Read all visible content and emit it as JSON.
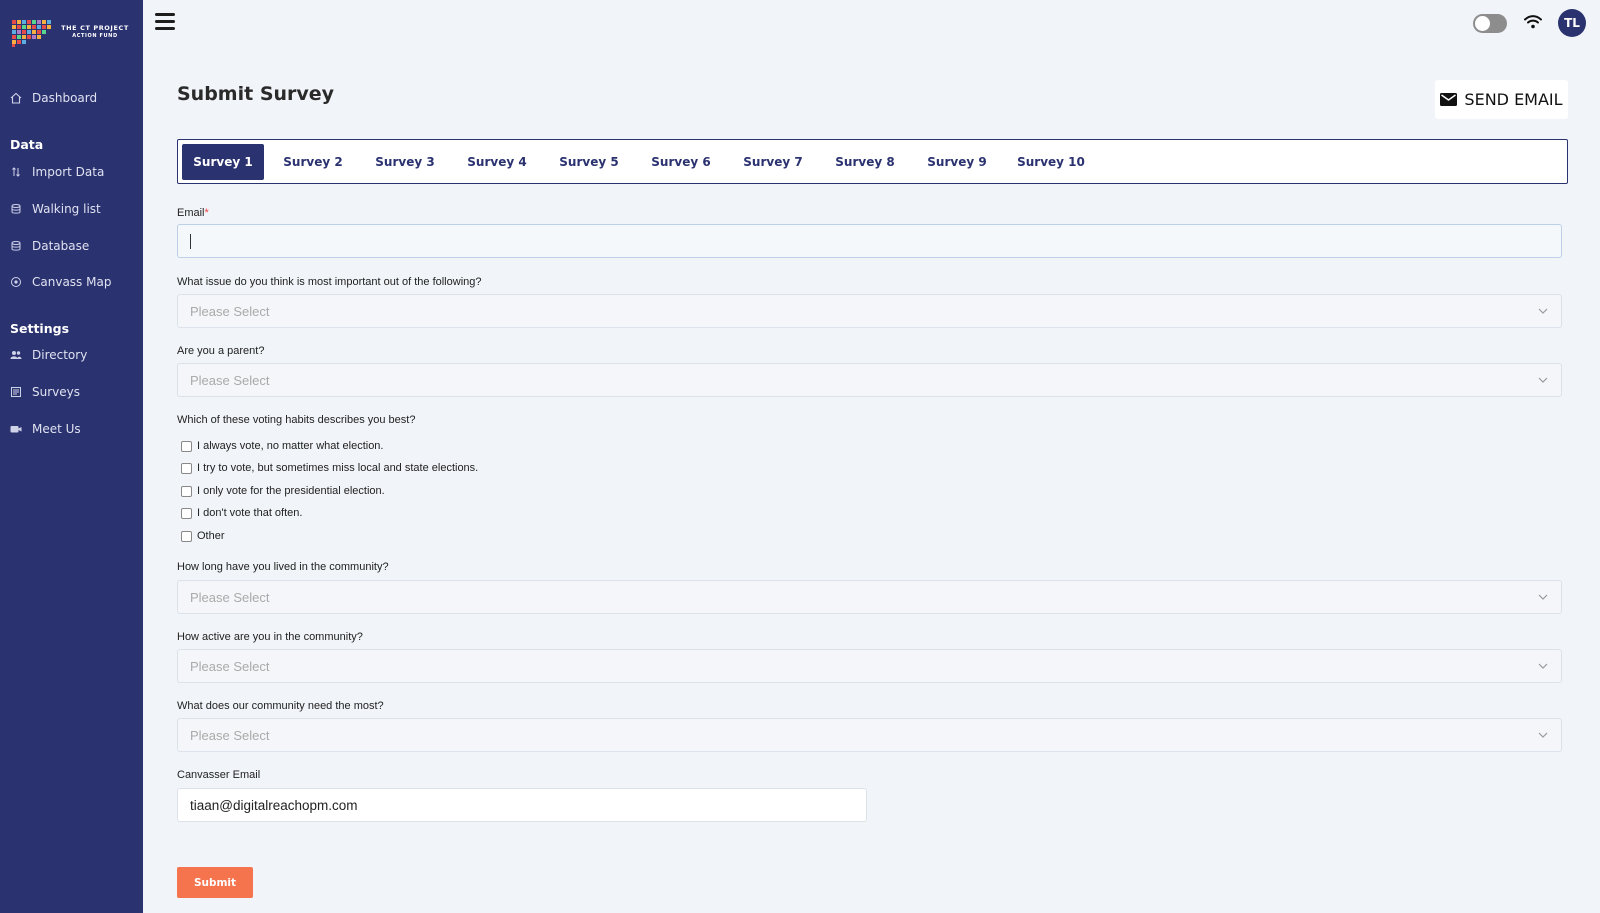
{
  "brand": {
    "line1": "THE CT PROJECT",
    "line2": "ACTION FUND"
  },
  "sidebar": {
    "items": [
      {
        "label": "Dashboard",
        "icon": "home-icon"
      },
      {
        "label": "Import Data",
        "icon": "import-icon"
      },
      {
        "label": "Walking list",
        "icon": "stack-icon"
      },
      {
        "label": "Database",
        "icon": "database-icon"
      },
      {
        "label": "Canvass Map",
        "icon": "map-pin-icon"
      },
      {
        "label": "Directory",
        "icon": "people-icon"
      },
      {
        "label": "Surveys",
        "icon": "survey-icon"
      },
      {
        "label": "Meet Us",
        "icon": "video-icon"
      }
    ],
    "sections": {
      "data": "Data",
      "settings": "Settings"
    }
  },
  "header": {
    "avatar_initials": "TL"
  },
  "page": {
    "title": "Submit Survey",
    "send_email": "SEND EMAIL"
  },
  "tabs": [
    "Survey 1",
    "Survey 2",
    "Survey 3",
    "Survey 4",
    "Survey 5",
    "Survey 6",
    "Survey 7",
    "Survey 8",
    "Survey 9",
    "Survey 10"
  ],
  "active_tab": "Survey 1",
  "form": {
    "email_label": "Email",
    "email_required": "*",
    "email_value": "",
    "q_issue": "What issue do you think is most important out of the following?",
    "q_parent": "Are you a parent?",
    "q_voting": "Which of these voting habits describes you best?",
    "voting_options": [
      "I always vote, no matter what election.",
      "I try to vote, but sometimes miss local and state elections.",
      "I only vote for the presidential election.",
      "I don't vote that often.",
      "Other"
    ],
    "q_lived": "How long have you lived in the community?",
    "q_active": "How active are you in the community?",
    "q_need": "What does our community need the most?",
    "select_placeholder": "Please Select",
    "canvasser_label": "Canvasser Email",
    "canvasser_value": "tiaan@digitalreachopm.com",
    "submit_label": "Submit"
  },
  "colors": {
    "sidebar": "#2b3270",
    "accent": "#f5734d",
    "tab_active": "#2b3270"
  }
}
